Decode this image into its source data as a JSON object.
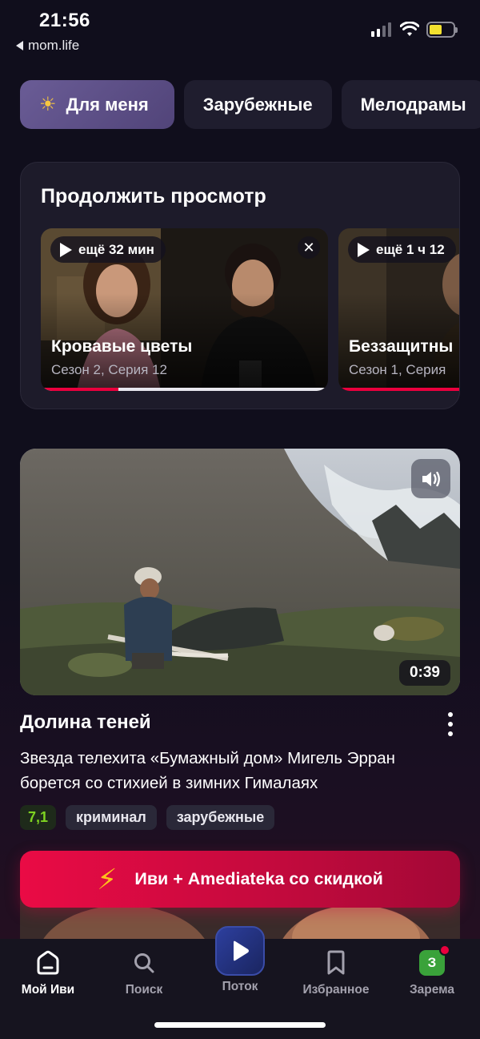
{
  "status_bar": {
    "time": "21:56",
    "back_app": "mom.life"
  },
  "categories": [
    {
      "label": "Для меня",
      "active": true
    },
    {
      "label": "Зарубежные",
      "active": false
    },
    {
      "label": "Мелодрамы",
      "active": false
    }
  ],
  "continue_watching": {
    "title": "Продолжить просмотр",
    "items": [
      {
        "remaining": "ещё 32 мин",
        "title": "Кровавые цветы",
        "subtitle": "Сезон 2, Серия 12",
        "progress": 0.27
      },
      {
        "remaining": "ещё 1 ч 12",
        "title": "Беззащитны",
        "subtitle": "Сезон 1, Серия",
        "progress": 1.0
      }
    ]
  },
  "featured": {
    "duration": "0:39",
    "title": "Долина теней",
    "description": "Звезда телехита «Бумажный дом» Мигель Эрран борется со стихией в зимних Гималаях",
    "rating": "7,1",
    "tags": [
      "криминал",
      "зарубежные"
    ]
  },
  "promo": {
    "label": "Иви + Amediateka со скидкой"
  },
  "tabbar": {
    "items": [
      {
        "label": "Мой Иви",
        "icon": "home-icon",
        "active": true
      },
      {
        "label": "Поиск",
        "icon": "search-icon",
        "active": false
      },
      {
        "label": "Поток",
        "icon": "play-icon",
        "active": false
      },
      {
        "label": "Избранное",
        "icon": "bookmark-icon",
        "active": false
      },
      {
        "label": "Зарема",
        "icon": "avatar",
        "active": false,
        "avatar_letter": "З"
      }
    ]
  },
  "colors": {
    "accent": "#ea003d",
    "background": "#100e1c",
    "rating": "#7ed321"
  }
}
